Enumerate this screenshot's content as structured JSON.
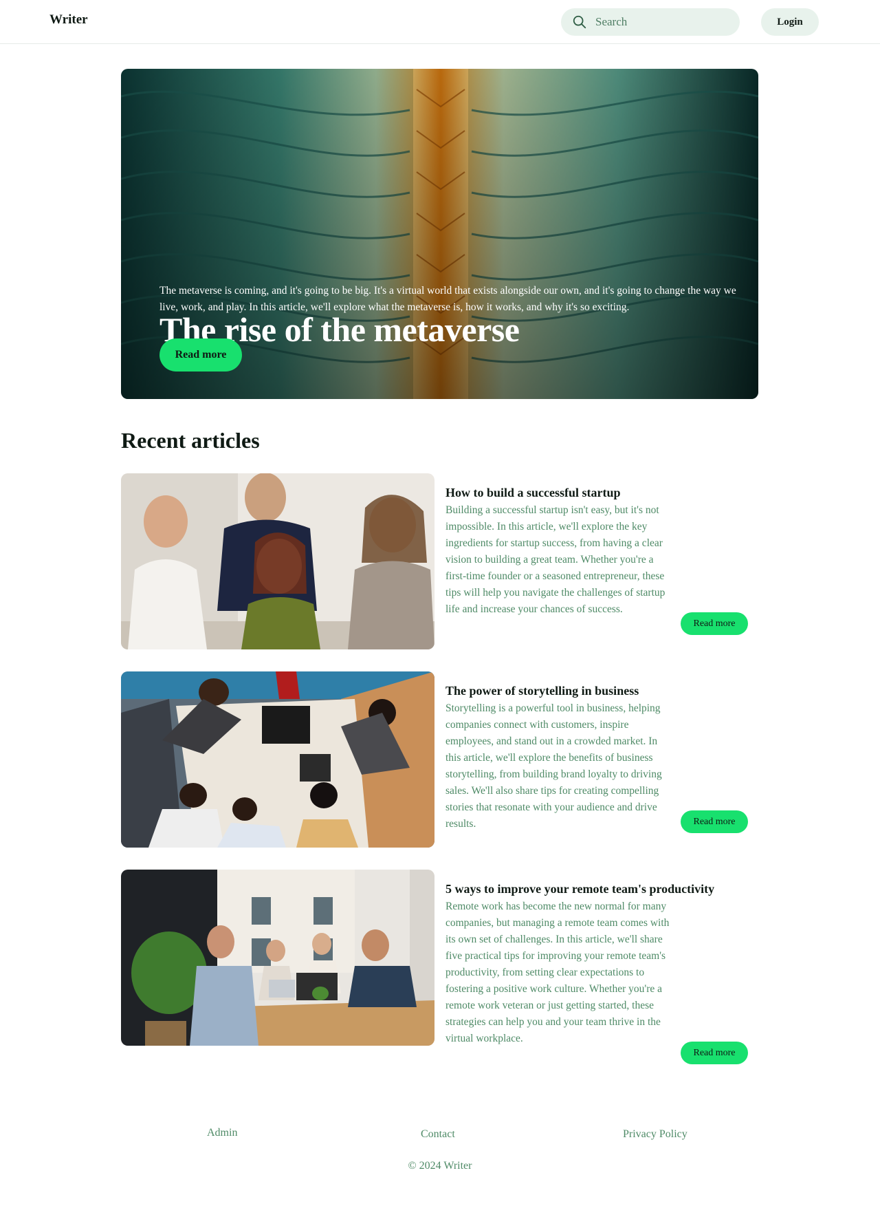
{
  "header": {
    "brand": "Writer",
    "search_placeholder": "Search",
    "login_label": "Login"
  },
  "hero": {
    "title": "The rise of the metaverse",
    "description": "The metaverse is coming, and it's going to be big. It's a virtual world that exists alongside our own, and it's going to change the way we live, work, and play. In this article, we'll explore what the metaverse is, how it works, and why it's so exciting.",
    "button_label": "Read more"
  },
  "recent": {
    "title": "Recent articles",
    "articles": [
      {
        "title": "How to build a successful startup",
        "body": "Building a successful startup isn't easy, but it's not impossible. In this article, we'll explore the key ingredients for startup success, from having a clear vision to building a great team. Whether you're a first-time founder or a seasoned entrepreneur, these tips will help you navigate the challenges of startup life and increase your chances of success.",
        "button_label": "Read more"
      },
      {
        "title": "The power of storytelling in business",
        "body": "Storytelling is a powerful tool in business, helping companies connect with customers, inspire employees, and stand out in a crowded market. In this article, we'll explore the benefits of business storytelling, from building brand loyalty to driving sales. We'll also share tips for creating compelling stories that resonate with your audience and drive results.",
        "button_label": "Read more"
      },
      {
        "title": "5 ways to improve your remote team's productivity",
        "body": "Remote work has become the new normal for many companies, but managing a remote team comes with its own set of challenges. In this article, we'll share five practical tips for improving your remote team's productivity, from setting clear expectations to fostering a positive work culture. Whether you're a remote work veteran or just getting started, these strategies can help you and your team thrive in the virtual workplace.",
        "button_label": "Read more"
      }
    ]
  },
  "footer": {
    "links": [
      "Admin",
      "Contact",
      "Privacy Policy"
    ],
    "copyright": "© 2024 Writer"
  },
  "colors": {
    "accent": "#18e06e",
    "muted_text": "#4e8a66",
    "chip_bg": "#e8f2ec"
  }
}
